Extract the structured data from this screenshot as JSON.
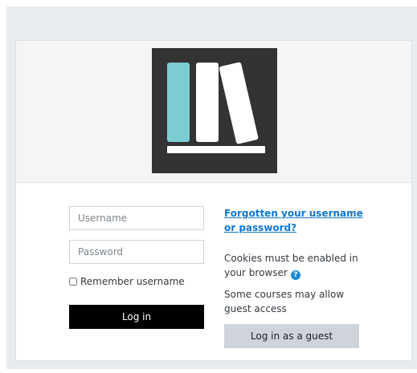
{
  "login": {
    "username_placeholder": "Username",
    "password_placeholder": "Password",
    "remember_label": "Remember username",
    "login_button": "Log in"
  },
  "help": {
    "forgot_link": "Forgotten your username or password?",
    "cookies_text": "Cookies must be enabled in your browser",
    "guest_text": "Some courses may allow guest access",
    "guest_button": "Log in as a guest"
  },
  "icons": {
    "help": "question-circle-icon",
    "logo": "books-logo"
  },
  "colors": {
    "logo_bg": "#333333",
    "accent": "#7bcdd2",
    "link": "#1177d1",
    "primary_button": "#000000",
    "secondary_button": "#ced4da"
  }
}
